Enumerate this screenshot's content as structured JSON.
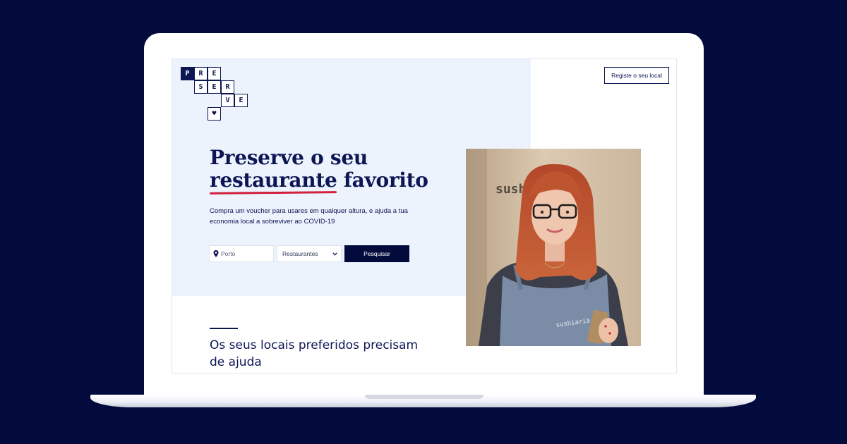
{
  "logo": {
    "row1": [
      "P",
      "R",
      "E"
    ],
    "row2": [
      "S",
      "E",
      "R"
    ],
    "row3": [
      "V",
      "E"
    ],
    "heart": "♥"
  },
  "header": {
    "register_label": "Registe o seu local"
  },
  "hero": {
    "title_line1": "Preserve o seu",
    "title_word_underlined": "restaurante",
    "title_word_after": " favorito",
    "subtitle": "Compra um voucher para usares em qualquer altura, e ajuda a tua economia local a sobreviver ao COVID-19"
  },
  "search": {
    "location_value": "Porto",
    "category_value": "Restaurantes",
    "submit_label": "Pesquisar"
  },
  "section": {
    "title": "Os seus locais preferidos precisam de ajuda"
  },
  "photo": {
    "wall_text": "sushiaria",
    "apron_text": "sushiaria"
  },
  "colors": {
    "page_bg": "#030b3d",
    "hero_bg": "#ecf3fd",
    "brand_navy": "#0d1654",
    "accent_red": "#d21f3c"
  }
}
